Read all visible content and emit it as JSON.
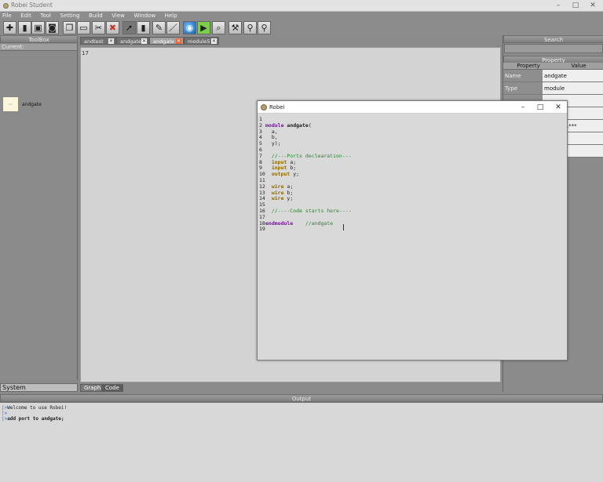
{
  "app": {
    "title": "Robei Student"
  },
  "menu": [
    "File",
    "Edit",
    "Tool",
    "Setting",
    "Build",
    "View",
    "Window",
    "Help"
  ],
  "toolbar": {
    "icons": [
      "new-icon",
      "open-icon",
      "save-icon",
      "save-all-icon",
      "copy-icon",
      "paste-icon",
      "cut-icon",
      "delete-icon",
      "pointer-icon",
      "module-icon",
      "brush-icon",
      "pen-icon",
      "globe-icon",
      "run-icon",
      "zoom-icon",
      "wand-icon",
      "link-icon",
      "pin-icon"
    ]
  },
  "toolbox": {
    "header": "ToolBox",
    "current": "Current:",
    "component_label": "andgate"
  },
  "system_tab": "System",
  "editor_tabs": [
    {
      "label": "andtest",
      "close_style": "light"
    },
    {
      "label": "andgate",
      "close_style": "light"
    },
    {
      "label": "andgate",
      "close_style": "orange",
      "active": true
    },
    {
      "label": "module5",
      "close_style": "light"
    }
  ],
  "canvas": {
    "line_number": "17"
  },
  "bottom_tabs": [
    "Graph",
    "Code"
  ],
  "right_panel": {
    "search_header": "Search",
    "property_header": "Property",
    "columns": [
      "Property",
      "Value"
    ],
    "rows": [
      {
        "key": "Name",
        "value": "andgate"
      },
      {
        "key": "Type",
        "value": "module"
      },
      {
        "key": "",
        "value": ""
      },
      {
        "key": "",
        "value": ""
      },
      {
        "key": "",
        "value": "andgate.***"
      },
      {
        "key": "",
        "value": ""
      },
      {
        "key": "",
        "value": ""
      },
      {
        "key": "",
        "value": ""
      }
    ]
  },
  "output": {
    "header": "Output",
    "lines": [
      {
        "prompt": "|>",
        "text": "Welcome to use Robei!"
      },
      {
        "prompt": "|>",
        "text": ""
      },
      {
        "prompt": "|>",
        "text": "add port to andgate;"
      }
    ]
  },
  "dialog": {
    "title": "Robei",
    "code_lines": [
      {
        "n": "1",
        "tokens": []
      },
      {
        "n": "2",
        "tokens": [
          {
            "t": "kw",
            "v": "module "
          },
          {
            "t": "nm",
            "v": "andgate"
          },
          {
            "t": "txt",
            "v": "("
          }
        ]
      },
      {
        "n": "3",
        "tokens": [
          {
            "t": "txt",
            "v": "  a,"
          }
        ]
      },
      {
        "n": "4",
        "tokens": [
          {
            "t": "txt",
            "v": "  b,"
          }
        ]
      },
      {
        "n": "5",
        "tokens": [
          {
            "t": "txt",
            "v": "  y);"
          }
        ]
      },
      {
        "n": "6",
        "tokens": []
      },
      {
        "n": "7",
        "tokens": [
          {
            "t": "cm",
            "v": "  //---Ports declearation---"
          }
        ]
      },
      {
        "n": "8",
        "tokens": [
          {
            "t": "port",
            "v": "  input "
          },
          {
            "t": "txt",
            "v": "a;"
          }
        ]
      },
      {
        "n": "9",
        "tokens": [
          {
            "t": "port",
            "v": "  input "
          },
          {
            "t": "txt",
            "v": "b;"
          }
        ]
      },
      {
        "n": "10",
        "tokens": [
          {
            "t": "port",
            "v": "  output "
          },
          {
            "t": "txt",
            "v": "y;"
          }
        ]
      },
      {
        "n": "11",
        "tokens": []
      },
      {
        "n": "12",
        "tokens": [
          {
            "t": "wire",
            "v": "  wire "
          },
          {
            "t": "txt",
            "v": "a;"
          }
        ]
      },
      {
        "n": "13",
        "tokens": [
          {
            "t": "wire",
            "v": "  wire "
          },
          {
            "t": "txt",
            "v": "b;"
          }
        ]
      },
      {
        "n": "14",
        "tokens": [
          {
            "t": "wire",
            "v": "  wire "
          },
          {
            "t": "txt",
            "v": "y;"
          }
        ]
      },
      {
        "n": "15",
        "tokens": []
      },
      {
        "n": "16",
        "tokens": [
          {
            "t": "cm",
            "v": "  //----Code starts here----"
          }
        ]
      },
      {
        "n": "17",
        "tokens": []
      },
      {
        "n": "18",
        "tokens": [
          {
            "t": "kw",
            "v": "endmodule"
          },
          {
            "t": "txt",
            "v": "    "
          },
          {
            "t": "cm",
            "v": "//andgate"
          }
        ]
      },
      {
        "n": "19",
        "tokens": []
      }
    ]
  }
}
